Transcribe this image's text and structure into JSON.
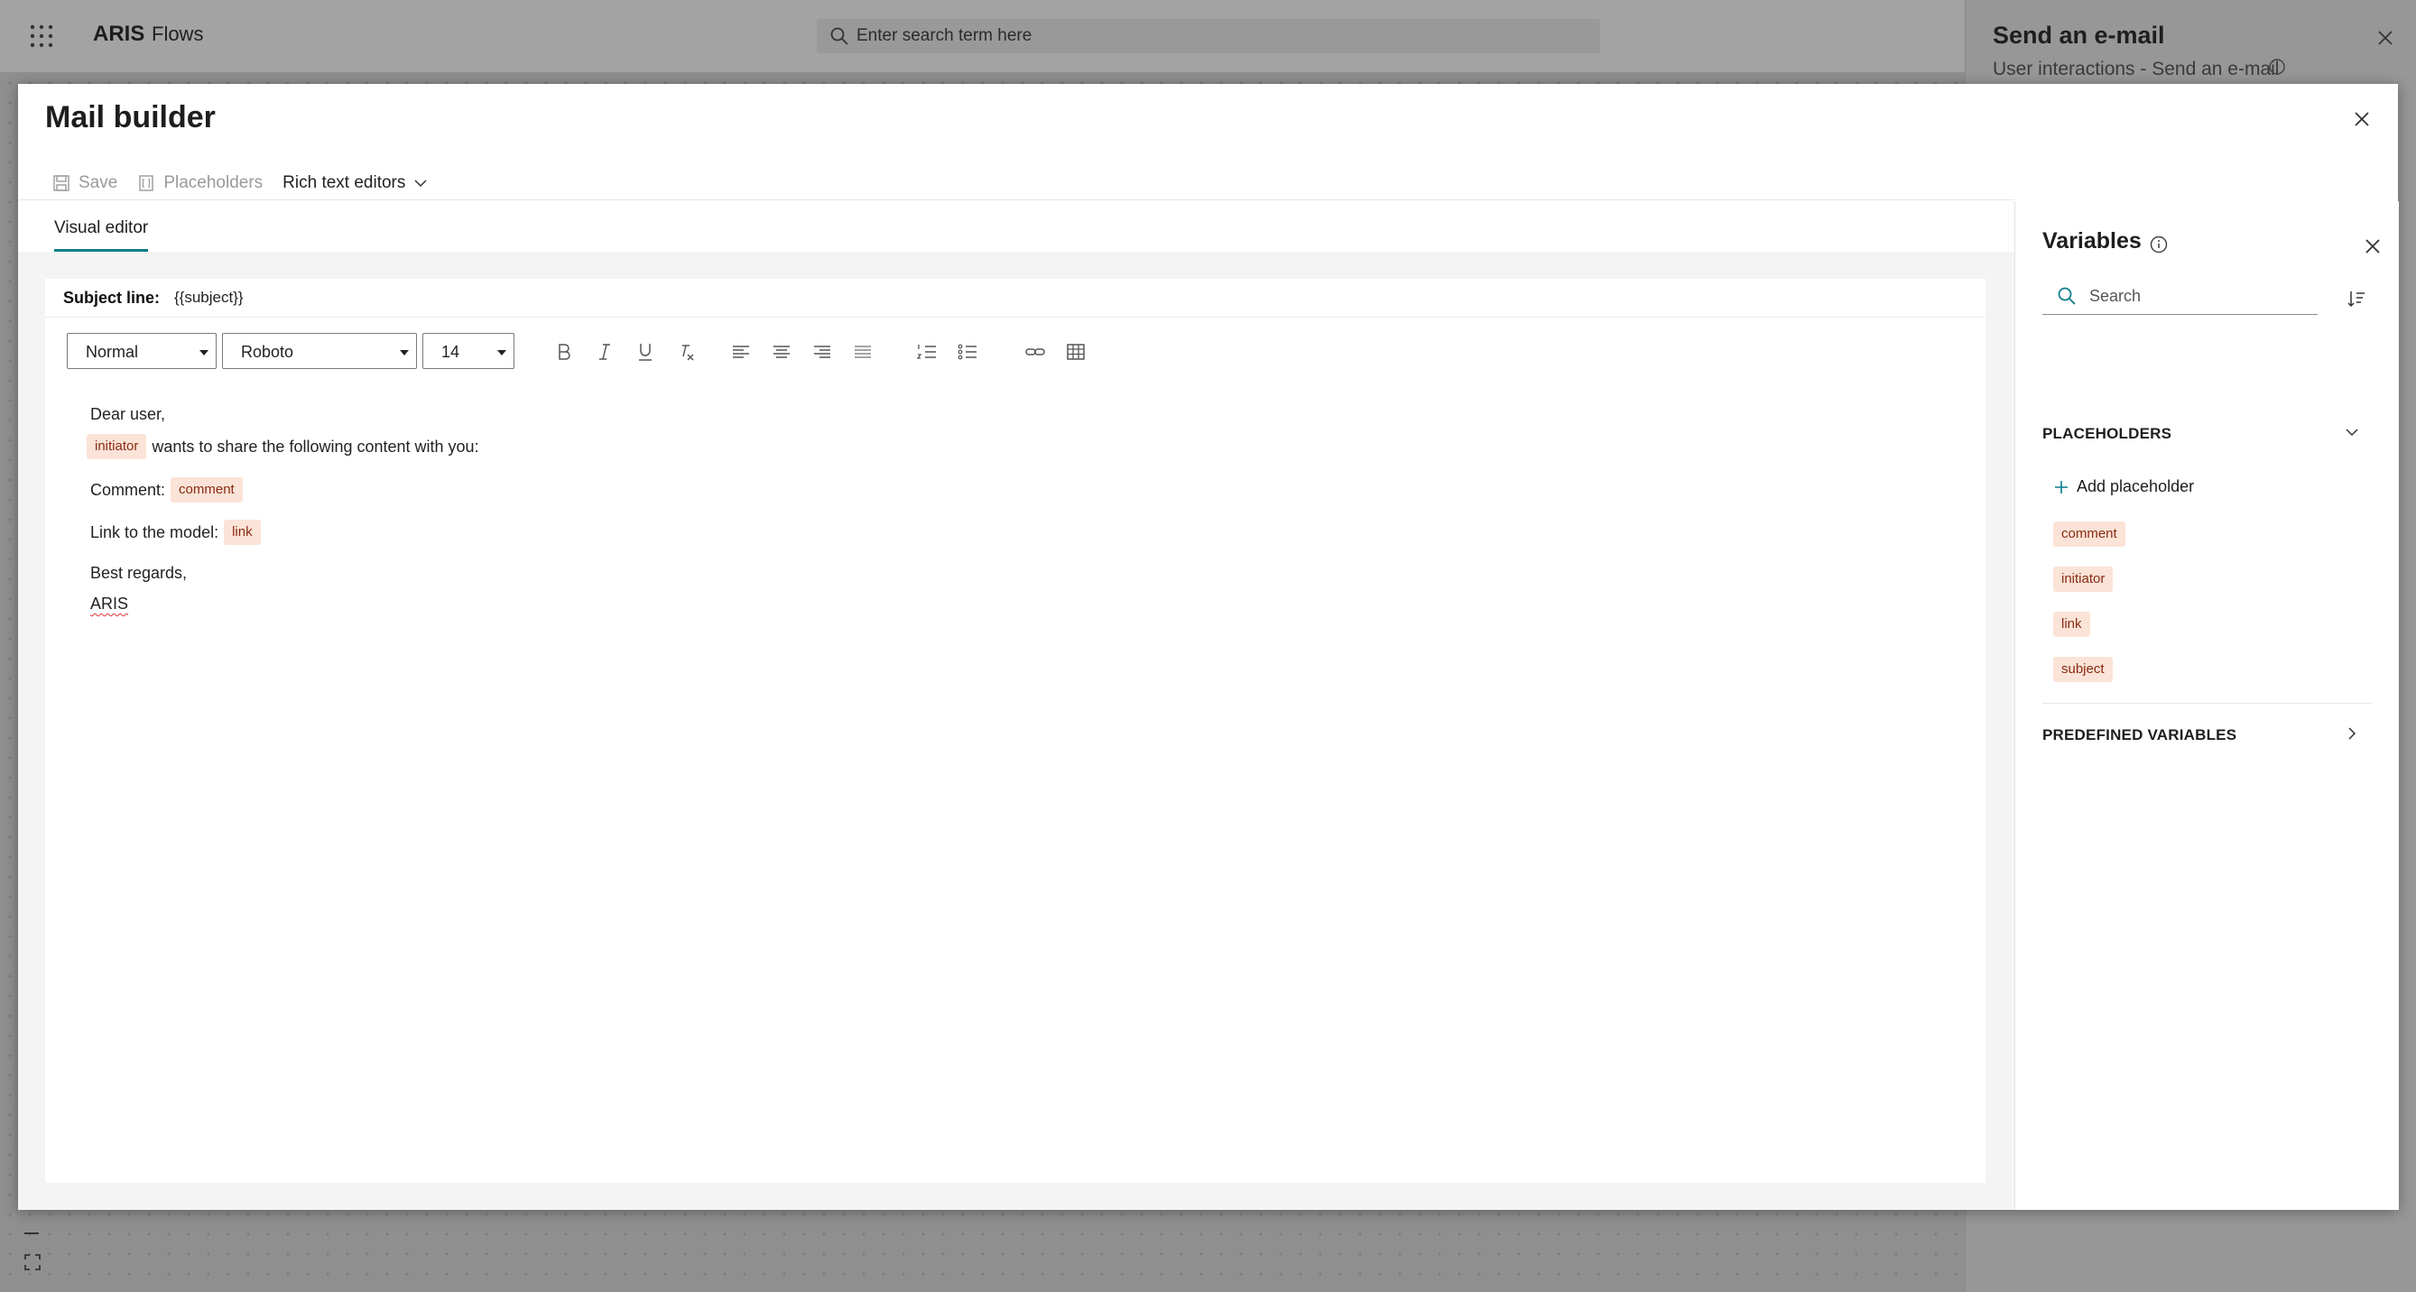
{
  "app": {
    "brand": "ARIS",
    "section": "Flows",
    "search_placeholder": "Enter search term here"
  },
  "side_panel": {
    "title": "Send an e-mail",
    "subtitle": "User interactions - Send an e-mail"
  },
  "modal": {
    "title": "Mail builder",
    "toolbar": {
      "save_label": "Save",
      "placeholders_label": "Placeholders",
      "rich_text_label": "Rich text editors"
    },
    "tabs": [
      {
        "label": "Visual editor",
        "active": true
      }
    ],
    "subject": {
      "label": "Subject line:",
      "value": "{{subject}}"
    },
    "format": {
      "style": "Normal",
      "font": "Roboto",
      "size": "14"
    },
    "body": {
      "greeting": "Dear user,",
      "initiator_chip": "initiator",
      "share_text": "wants to share the following content with you:",
      "comment_label": "Comment:",
      "comment_chip": "comment",
      "link_label": "Link to the model:",
      "link_chip": "link",
      "closing": "Best regards,",
      "signature": "ARIS"
    }
  },
  "variables": {
    "title": "Variables",
    "search_placeholder": "Search",
    "placeholders_header": "PLACEHOLDERS",
    "add_placeholder_label": "Add placeholder",
    "placeholders": [
      "comment",
      "initiator",
      "link",
      "subject"
    ],
    "predefined_header": "PREDEFINED VARIABLES"
  },
  "colors": {
    "accent": "#0a7d8c",
    "chip_bg": "#fbe3d7",
    "chip_text": "#8a2b12"
  }
}
